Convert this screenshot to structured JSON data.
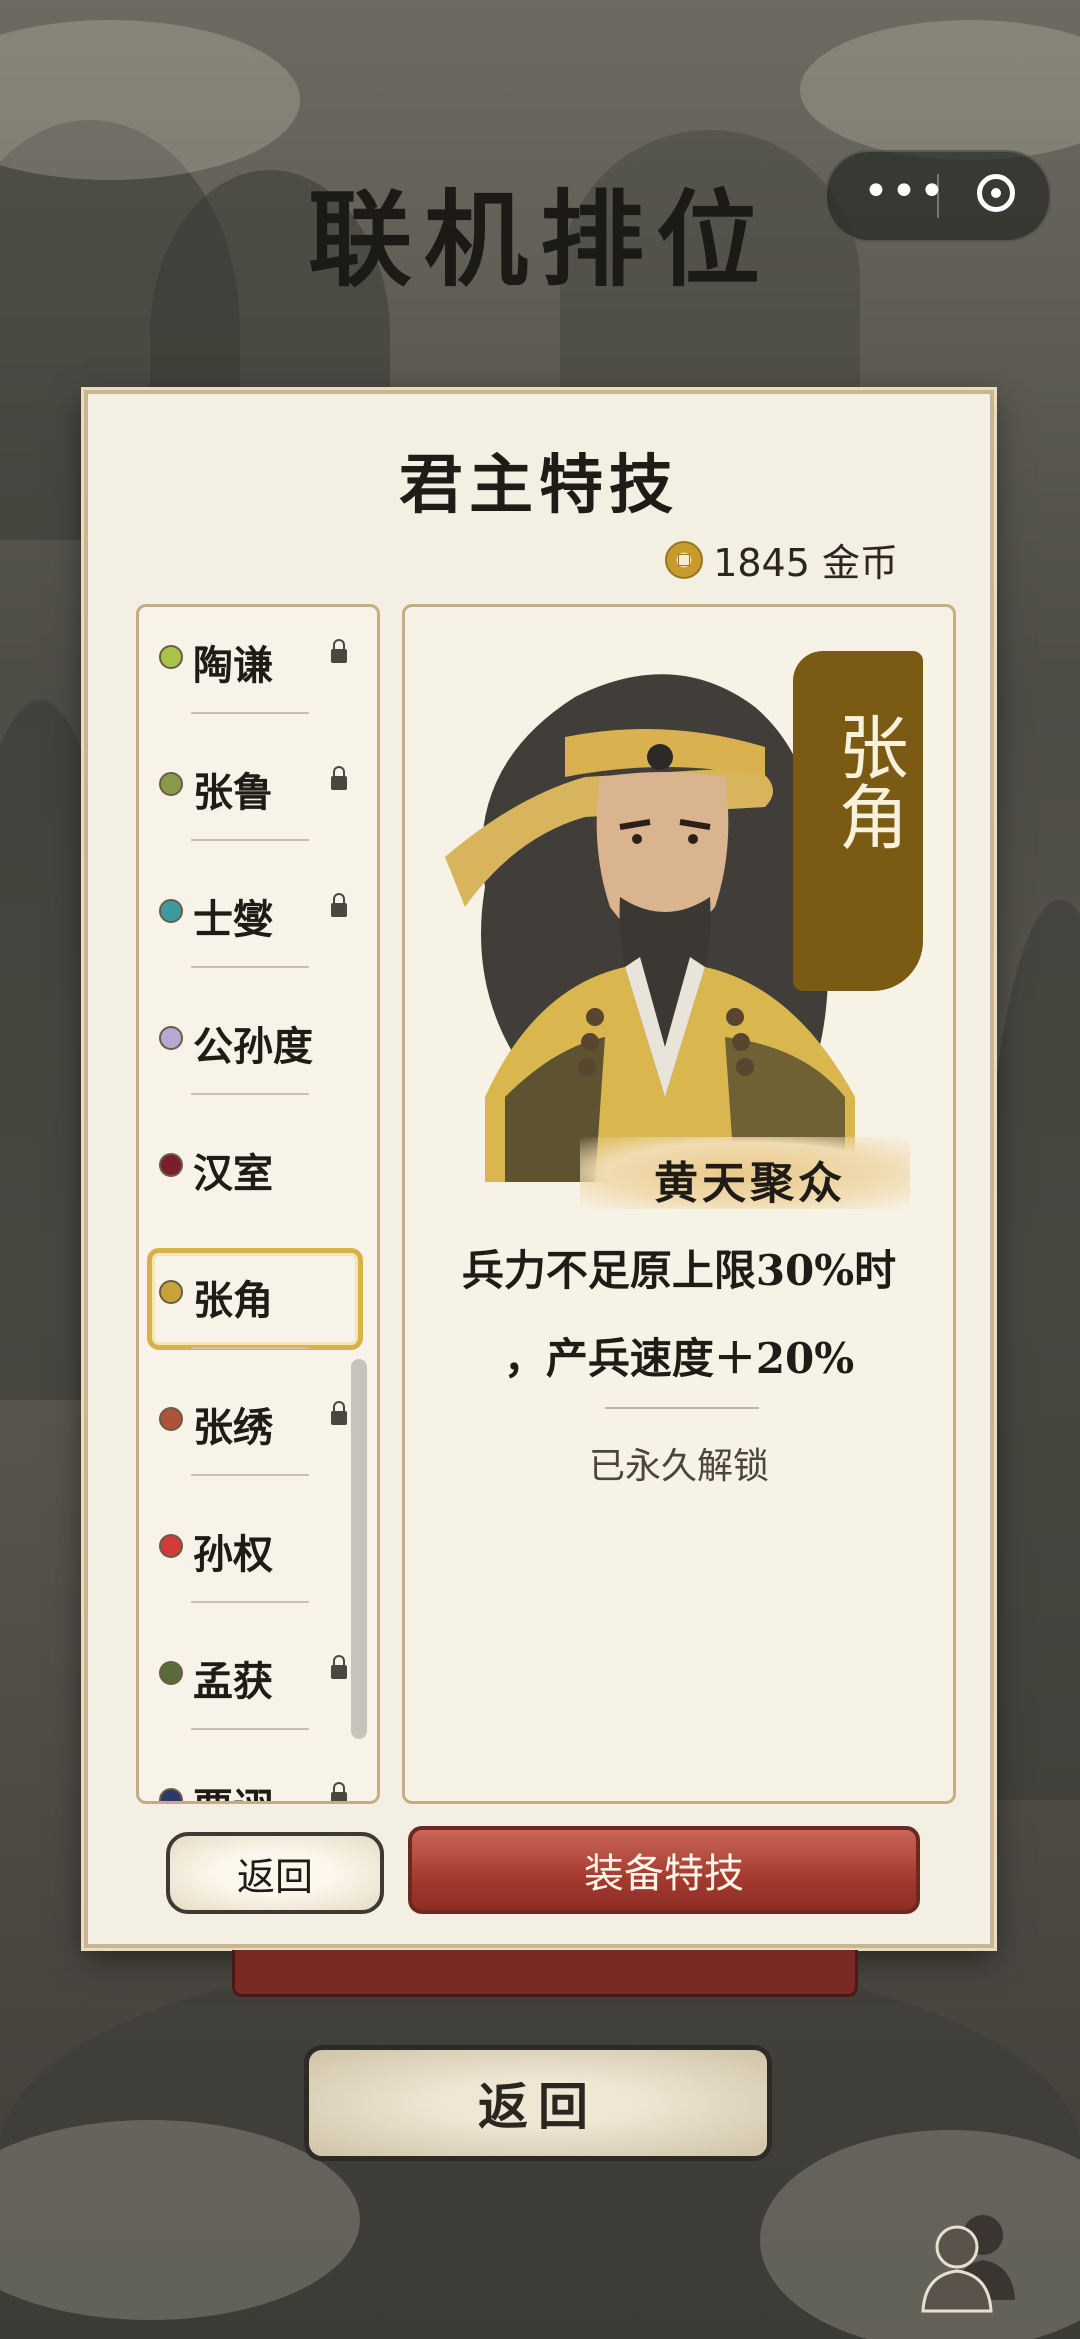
{
  "page_title": "联机排位",
  "dialog": {
    "title": "君主特技",
    "coins": "1845 金币"
  },
  "lords": [
    {
      "name": "陶谦",
      "dot_color": "#a9c24a",
      "locked": true
    },
    {
      "name": "张鲁",
      "dot_color": "#8a9a4a",
      "locked": true
    },
    {
      "name": "士燮",
      "dot_color": "#3e9aa0",
      "locked": true
    },
    {
      "name": "公孙度",
      "dot_color": "#b8a6d4",
      "locked": false
    },
    {
      "name": "汉室",
      "dot_color": "#7a1f2a",
      "locked": false
    },
    {
      "name": "张角",
      "dot_color": "#c9a23a",
      "locked": false,
      "selected": true
    },
    {
      "name": "张绣",
      "dot_color": "#b0523a",
      "locked": true
    },
    {
      "name": "孙权",
      "dot_color": "#d43a3a",
      "locked": false
    },
    {
      "name": "孟获",
      "dot_color": "#5a6a3a",
      "locked": true
    },
    {
      "name": "贾诩",
      "dot_color": "#2a3a6a",
      "locked": true
    }
  ],
  "detail": {
    "banner_name": "张角",
    "skill_name": "黄天聚众",
    "desc_line1": "兵力不足原上限30%时",
    "desc_line2": "，产兵速度＋20%",
    "status": "已永久解锁"
  },
  "buttons": {
    "back_small": "返回",
    "equip": "装备特技",
    "back_main": "返回"
  },
  "icons": {
    "menu": "more-dots-icon",
    "close": "target-circle-icon",
    "coin": "coin-icon",
    "lock": "lock-icon",
    "friends": "friends-icon"
  }
}
